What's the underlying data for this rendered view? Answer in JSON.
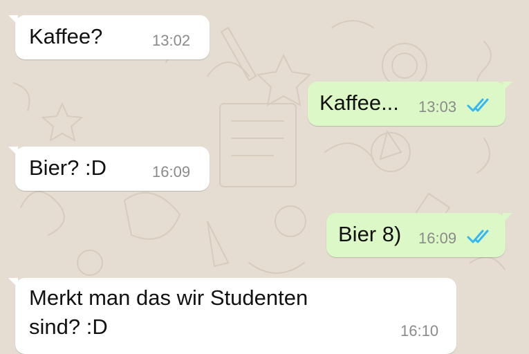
{
  "chat": {
    "messages": [
      {
        "direction": "incoming",
        "text": "Kaffee?",
        "time": "13:02"
      },
      {
        "direction": "outgoing",
        "text": "Kaffee...",
        "time": "13:03",
        "status": "read",
        "status_icon": "double-check-icon"
      },
      {
        "direction": "incoming",
        "text": "Bier? :D",
        "time": "16:09"
      },
      {
        "direction": "outgoing",
        "text": "Bier 8)",
        "time": "16:09",
        "status": "read",
        "status_icon": "double-check-icon"
      },
      {
        "direction": "incoming",
        "text_lines": [
          "Merkt man das wir Studenten",
          "sind? :D"
        ],
        "time": "16:10"
      }
    ]
  },
  "colors": {
    "background": "#e5ddd2",
    "incoming_bubble": "#ffffff",
    "outgoing_bubble": "#dcf8c6",
    "read_tick": "#34b7f1"
  }
}
